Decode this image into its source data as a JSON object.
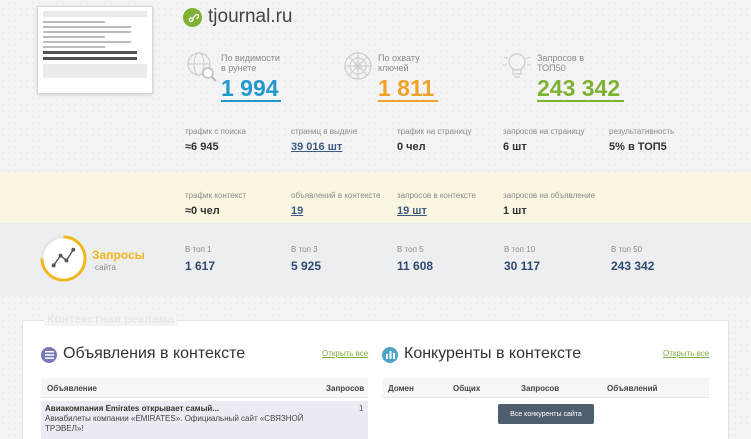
{
  "site": {
    "title": "tjournal.ru"
  },
  "metrics": [
    {
      "label": "По видимости в рунете",
      "value": "1 994",
      "color": "#2597cf"
    },
    {
      "label": "По охвату ключей",
      "value": "1 811",
      "color": "#f0a32b"
    },
    {
      "label": "Запросов в ТОП50",
      "value": "243 342",
      "color": "#7fb234"
    }
  ],
  "stats_row": [
    {
      "label": "трафик с поиска",
      "value": "≈6 945"
    },
    {
      "label": "страниц в выдаче",
      "value": "39 016 шт"
    },
    {
      "label": "трафик на страницу",
      "value": "0 чел"
    },
    {
      "label": "запросов на страницу",
      "value": "6 шт"
    },
    {
      "label": "результативность",
      "value": "5% в ТОП5"
    }
  ],
  "context_row": [
    {
      "label": "трафик контекст",
      "value": "≈0 чел"
    },
    {
      "label": "объявлений в контексте",
      "value": "19"
    },
    {
      "label": "запросов в контексте",
      "value": "19 шт"
    },
    {
      "label": "запросов на объявление",
      "value": "1 шт"
    }
  ],
  "queries": {
    "title": "Запросы",
    "subtitle": "сайта",
    "items": [
      {
        "label": "В топ 1",
        "value": "1 617"
      },
      {
        "label": "В топ 3",
        "value": "5 925"
      },
      {
        "label": "В топ 5",
        "value": "11 608"
      },
      {
        "label": "В топ 10",
        "value": "30 117"
      },
      {
        "label": "В топ 50",
        "value": "243 342"
      }
    ]
  },
  "context_ads": {
    "title": "Контекстная реклама",
    "ads": {
      "title": "Объявления в контексте",
      "link": "Открыть все",
      "col_ad": "Объявление",
      "col_queries": "Запросов",
      "row": {
        "title": "Авиакомпания Emirates открывает самый...",
        "desc": "Авиабилеты компании «EMIRATES». Официальный сайт «СВЯЗНОЙ ТРЭВЕЛ»!",
        "count": "1"
      }
    },
    "competitors": {
      "title": "Конкуренты в контексте",
      "link": "Открыть все",
      "columns": [
        "Домен",
        "Общих",
        "Запросов",
        "Объявлений"
      ],
      "button": "Все конкуренты сайта"
    }
  },
  "colors": {
    "accent_blue": "#2597cf",
    "accent_orange": "#f0a32b",
    "accent_green": "#7fb234",
    "link": "#3d5a84"
  }
}
